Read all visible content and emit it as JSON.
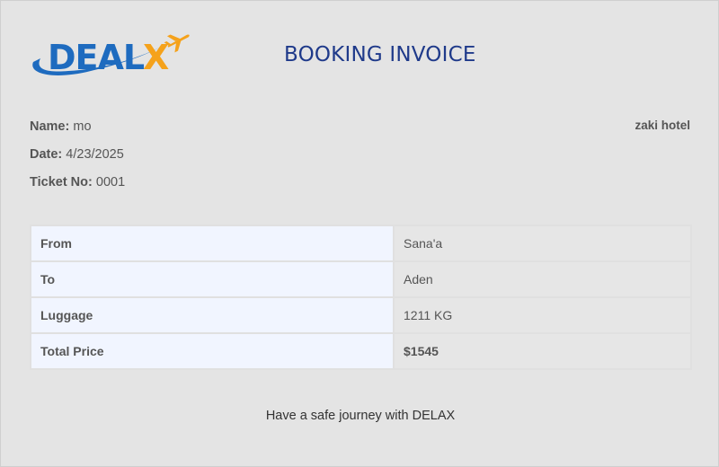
{
  "brand": {
    "logo_text_dark": "DEAL",
    "logo_text_accent": "X",
    "logo_icon": "airplane-icon",
    "colors": {
      "blue": "#1e6bbf",
      "orange": "#f5a21b",
      "title": "#1f3a8a"
    }
  },
  "header": {
    "title": "BOOKING INVOICE"
  },
  "info": {
    "name_label": "Name:",
    "name_value": "mo",
    "date_label": "Date:",
    "date_value": "4/23/2025",
    "ticket_label": "Ticket No:",
    "ticket_value": "0001",
    "hotel": "zaki hotel"
  },
  "details": {
    "rows": [
      {
        "label": "From",
        "value": "Sana'a"
      },
      {
        "label": "To",
        "value": "Aden"
      },
      {
        "label": "Luggage",
        "value": "1211 KG"
      },
      {
        "label": "Total Price",
        "value": "$1545"
      }
    ]
  },
  "footer": {
    "message": "Have a safe journey with DELAX"
  }
}
